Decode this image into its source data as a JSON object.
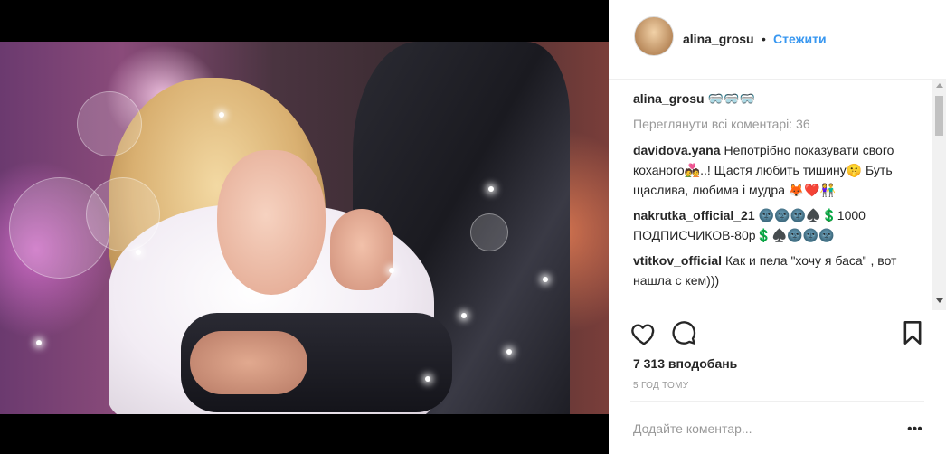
{
  "header": {
    "username": "alina_grosu",
    "dot": "•",
    "follow_label": "Стежити"
  },
  "caption": {
    "username": "alina_grosu",
    "text": "🥽🥽🥽"
  },
  "view_all_label": "Переглянути всі коментарі: 36",
  "comments": [
    {
      "user": "davidova.yana",
      "text": "Непотрібно показувати свого коханого💑..! Щастя любить тишину🤫 Буть щаслива, любима і мудра 🦊❤️👫"
    },
    {
      "user": "nakrutka_official_21",
      "text": "🌚🌚🌚♠️💲1000 ПОДПИСЧИКОВ-80р💲♠️🌚🌚🌚"
    },
    {
      "user": "vtitkov_official",
      "text": "Как и пела \"хочу я баса\" , вот нашла с кем)))"
    }
  ],
  "icons": {
    "like": "heart-outline-icon",
    "comment": "speech-bubble-icon",
    "save": "bookmark-icon",
    "more": "ellipsis-icon"
  },
  "likes_text": "7 313 вподобань",
  "time_text": "5 ГОД ТОМУ",
  "add_comment_placeholder": "Додайте коментар...",
  "more_options": "•••"
}
